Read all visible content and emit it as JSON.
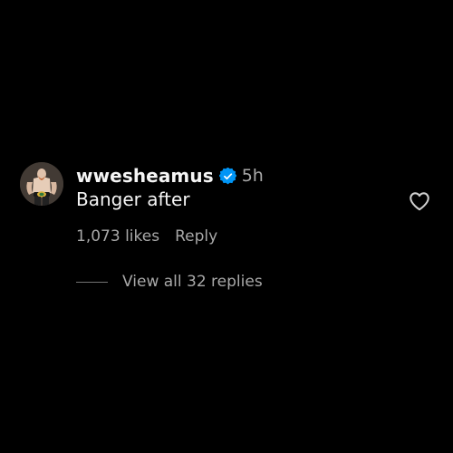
{
  "comment": {
    "username": "wwesheamus",
    "verified": true,
    "time": "5h",
    "text": "Banger after",
    "likes": "1,073 likes",
    "reply_label": "Reply",
    "view_replies_label": "View all 32 replies"
  },
  "icons": {
    "verified": "verified-badge-icon",
    "like": "heart-outline-icon",
    "avatar": "profile-avatar"
  },
  "colors": {
    "background": "#000000",
    "primary_text": "#f5f5f5",
    "secondary_text": "#a8a8a8",
    "verified_blue": "#0095f6"
  }
}
